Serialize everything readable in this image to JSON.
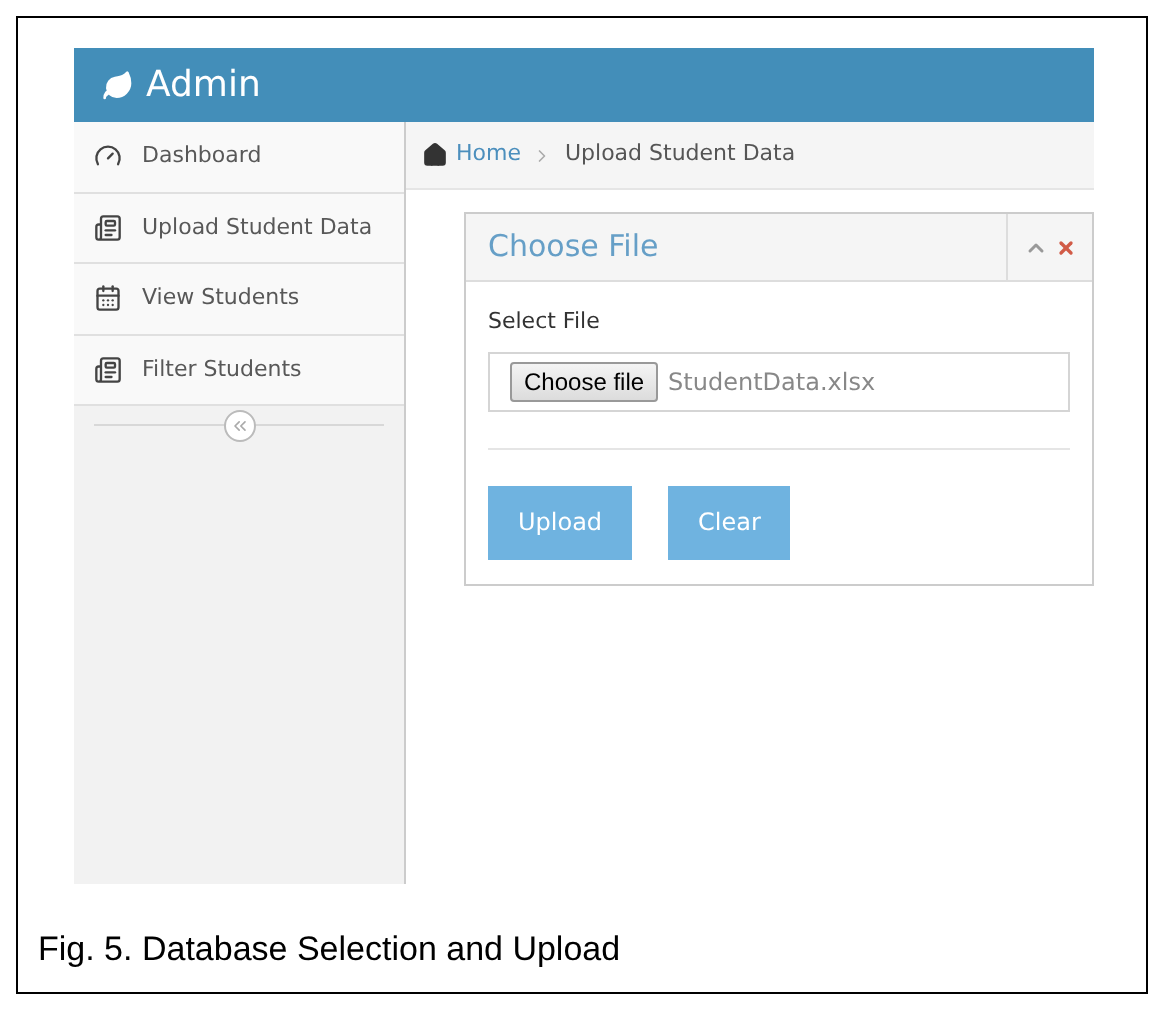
{
  "header": {
    "title": "Admin"
  },
  "sidebar": {
    "items": [
      {
        "label": "Dashboard"
      },
      {
        "label": "Upload Student Data"
      },
      {
        "label": "View Students"
      },
      {
        "label": "Filter Students"
      }
    ]
  },
  "breadcrumb": [
    "Home",
    "Upload Student Data"
  ],
  "card": {
    "title": "Choose File",
    "field_label": "Select File",
    "file_button": "Choose file",
    "file_name": "StudentData.xlsx",
    "buttons": [
      "Upload",
      "Clear"
    ]
  },
  "caption": "Fig. 5. Database Selection and Upload"
}
